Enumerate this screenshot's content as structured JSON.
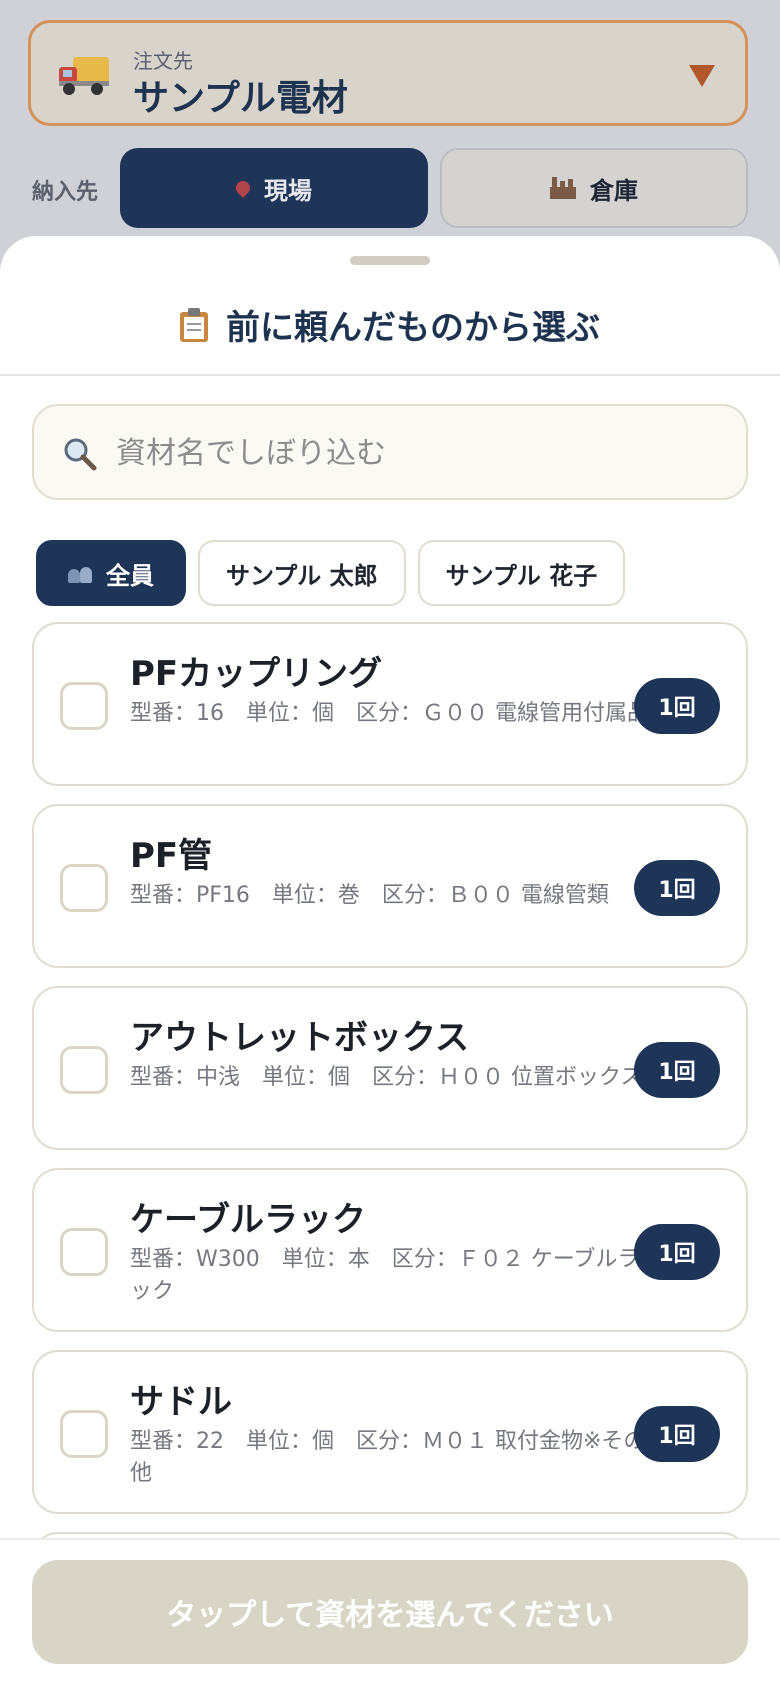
{
  "background": {
    "supplier_label": "注文先",
    "supplier_name": "サンプル電材",
    "destination_label": "納入先",
    "destination_site": "現場",
    "destination_warehouse": "倉庫"
  },
  "sheet": {
    "title": "前に頼んだものから選ぶ",
    "search_placeholder": "資材名でしぼり込む",
    "filters": [
      {
        "label": "全員",
        "active": true
      },
      {
        "label": "サンプル 太郎",
        "active": false
      },
      {
        "label": "サンプル 花子",
        "active": false
      }
    ],
    "items": [
      {
        "name": "PFカップリング",
        "meta": "型番：16　単位：個　区分：Ｇ００ 電線管用付属品",
        "count": "1回"
      },
      {
        "name": "PF管",
        "meta": "型番：PF16　単位：巻　区分：Ｂ００ 電線管類",
        "count": "1回"
      },
      {
        "name": "アウトレットボックス",
        "meta": "型番：中浅　単位：個　区分：Ｈ００ 位置ボックス",
        "count": "1回"
      },
      {
        "name": "ケーブルラック",
        "meta": "型番：W300　単位：本　区分：Ｆ０２ ケーブルラック",
        "count": "1回"
      },
      {
        "name": "サドル",
        "meta": "型番：22　単位：個　区分：Ｍ０１ 取付金物※その他",
        "count": "1回"
      }
    ],
    "submit_label": "タップして資材を選んでください"
  },
  "colors": {
    "navy": "#1e3557",
    "accent": "#b2572a",
    "disabled": "#d9d5c6"
  },
  "icons": [
    "truck-icon",
    "dropdown-caret-icon",
    "pin-icon",
    "factory-icon",
    "clipboard-icon",
    "search-icon",
    "people-icon"
  ]
}
